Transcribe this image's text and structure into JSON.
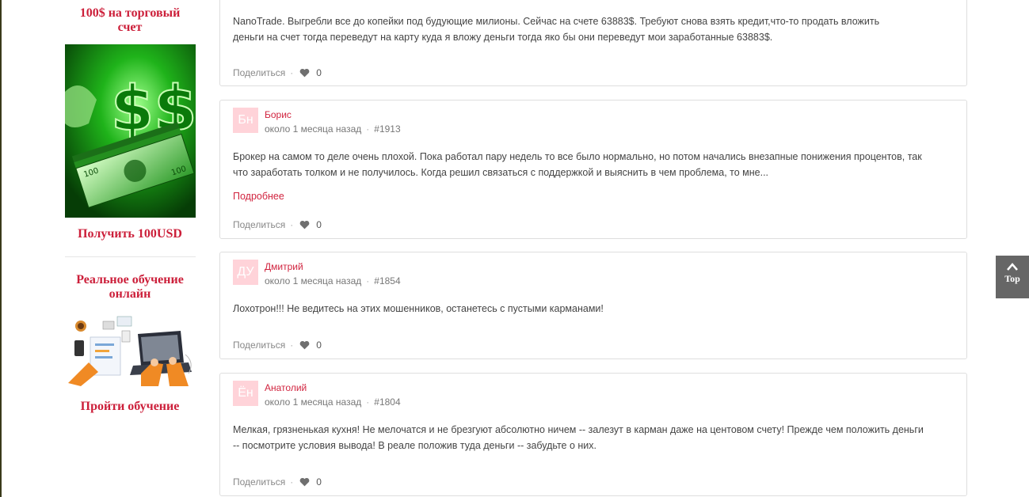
{
  "sidebar": {
    "promo1_title_line1": "100$ на торговый",
    "promo1_title_line2": "счет",
    "promo1_link": "Получить 100USD",
    "promo2_title_line1": "Реальное обучение",
    "promo2_title_line2": "онлайн",
    "promo2_link": "Пройти обучение"
  },
  "comments": [
    {
      "text_line1": "NanoTrade. Выгребли все до копейки под будующие милионы. Сейчас на счете 63883$. Требуют снова взять кредит,что-то продать вложить",
      "text_line2": "деньги на счет тогда переведут на карту куда я вложу деньги тогда яко бы они переведут мои заработанные 63883$.",
      "share": "Поделиться",
      "likes": "0"
    },
    {
      "initials": "Бн",
      "author": "Борис",
      "time": "около 1 месяца назад",
      "id": "#1913",
      "text_line1": "Брокер на самом то деле очень плохой. Пока работал пару недель то все было нормально, но потом начались внезапные понижения процентов, так",
      "text_line2": "что заработать толком и не получилось. Когда решил связаться с поддержкой и выяснить в чем проблема, то мне...",
      "more": "Подробнее",
      "share": "Поделиться",
      "likes": "0"
    },
    {
      "initials": "ДУ",
      "author": "Дмитрий",
      "time": "около 1 месяца назад",
      "id": "#1854",
      "text_line1": "Лохотрон!!! Не ведитесь на этих мошенников, останетесь с пустыми карманами!",
      "share": "Поделиться",
      "likes": "0"
    },
    {
      "initials": "Ён",
      "author": "Анатолий",
      "time": "около 1 месяца назад",
      "id": "#1804",
      "text_line1": "Мелкая, грязненькая кухня! Не мелочатся и не брезгуют абсолютно ничем -- залезут в карман даже на центовом счету! Прежде чем положить деньги",
      "text_line2": "-- посмотрите условия вывода! В реале положив туда деньги -- забудьте о них.",
      "share": "Поделиться",
      "likes": "0"
    }
  ],
  "top_button": {
    "label": "Top"
  },
  "colors": {
    "accent": "#cc1f3a",
    "avatar_bg": "#ffd3d9",
    "top_btn": "#666666"
  }
}
